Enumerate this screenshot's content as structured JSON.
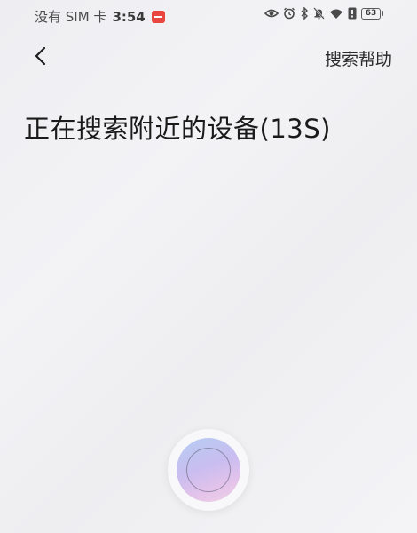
{
  "status_bar": {
    "carrier": "没有 SIM 卡",
    "time": "3:54",
    "battery_level": "63",
    "icons": [
      "eye-icon",
      "alarm-icon",
      "bluetooth-icon",
      "mute-bell-icon",
      "wifi-icon",
      "nfc-icon",
      "battery-icon"
    ]
  },
  "header": {
    "back_icon": "chevron-left-icon",
    "help_label": "搜索帮助"
  },
  "main": {
    "title": "正在搜索附近的设备(13S)"
  },
  "scan": {
    "icon": "scan-orb-icon"
  }
}
